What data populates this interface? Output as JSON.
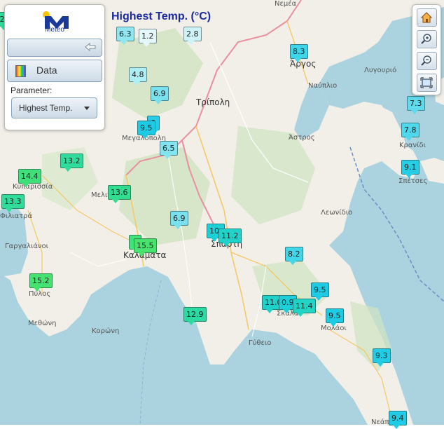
{
  "title": "Highest Temp. (°C)",
  "panel": {
    "logo_text": "Meteo",
    "data_label": "Data",
    "parameter_label": "Parameter:",
    "parameter_value": "Highest Temp.",
    "logo_icon": "meteo-logo-icon",
    "slider_icon": "arrow-left-icon",
    "data_icon": "color-scale-icon"
  },
  "toolbar": {
    "home_icon": "home-icon",
    "zoom_in_icon": "zoom-in-icon",
    "zoom_out_icon": "zoom-out-icon",
    "extent_icon": "full-extent-icon"
  },
  "places": [
    {
      "id": "nemea",
      "label": "Νεμέα"
    },
    {
      "id": "argos",
      "label": "Άργος"
    },
    {
      "id": "lygourio",
      "label": "Λυγουριό"
    },
    {
      "id": "nafplio",
      "label": "Ναύπλιο"
    },
    {
      "id": "tripoli",
      "label": "Τρίπολη"
    },
    {
      "id": "megalopoli",
      "label": "Μεγαλόπολη"
    },
    {
      "id": "astros",
      "label": "Άστρος"
    },
    {
      "id": "kranidi",
      "label": "Κρανίδι"
    },
    {
      "id": "spetses",
      "label": "Σπέτσες"
    },
    {
      "id": "kyparissia",
      "label": "Κυπαρισσία"
    },
    {
      "id": "meligalas",
      "label": "Μελιγαλάς"
    },
    {
      "id": "filiatra",
      "label": "Φιλιατρά"
    },
    {
      "id": "leonidio",
      "label": "Λεωνίδιο"
    },
    {
      "id": "gargalianoi",
      "label": "Γαργαλιάνοι"
    },
    {
      "id": "kalamata",
      "label": "Καλαμάτα"
    },
    {
      "id": "sparti",
      "label": "Σπάρτη"
    },
    {
      "id": "pylos",
      "label": "Πύλος"
    },
    {
      "id": "skala",
      "label": "Σκάλα"
    },
    {
      "id": "molaoi",
      "label": "Μολάοι"
    },
    {
      "id": "methoni",
      "label": "Μεθώνη"
    },
    {
      "id": "koroni",
      "label": "Κορώνη"
    },
    {
      "id": "gytheio",
      "label": "Γύθειο"
    },
    {
      "id": "neapoli",
      "label": "Νεάπ"
    }
  ],
  "markers": [
    {
      "value": "6.3",
      "color": "#8fe6f0"
    },
    {
      "value": "1.2",
      "color": "#e4f7fa"
    },
    {
      "value": "2.8",
      "color": "#cdf3f8"
    },
    {
      "value": "8.3",
      "color": "#3fd5ea"
    },
    {
      "value": "4.8",
      "color": "#aeeef5"
    },
    {
      "value": "6.9",
      "color": "#79e0ee"
    },
    {
      "value": "9",
      "color": "#26cde6"
    },
    {
      "value": "9.5",
      "color": "#1dcbe4"
    },
    {
      "value": "6.5",
      "color": "#83e3ef"
    },
    {
      "value": "7.3",
      "color": "#60dbec"
    },
    {
      "value": "7.8",
      "color": "#4fd7eb"
    },
    {
      "value": "9.1",
      "color": "#25cde5"
    },
    {
      "value": "13.2",
      "color": "#2fdc9b"
    },
    {
      "value": "14.4",
      "color": "#3fe07a"
    },
    {
      "value": "13.6",
      "color": "#33dd90"
    },
    {
      "value": "13.3",
      "color": "#30dc99"
    },
    {
      "value": "6.9",
      "color": "#79e0ee"
    },
    {
      "value": "10.",
      "color": "#1bd0d6"
    },
    {
      "value": "11.2",
      "color": "#20d3c8"
    },
    {
      "value": "1",
      "color": "#40e27a"
    },
    {
      "value": "15.5",
      "color": "#48e36c"
    },
    {
      "value": "8.2",
      "color": "#42d6ea"
    },
    {
      "value": "15.2",
      "color": "#46e270"
    },
    {
      "value": "9.5",
      "color": "#1dcbe4"
    },
    {
      "value": "11.0",
      "color": "#1ed2ca"
    },
    {
      "value": "0.9",
      "color": "#1ccfd8"
    },
    {
      "value": "11.4",
      "color": "#22d4c3"
    },
    {
      "value": "9.5",
      "color": "#1dcbe4"
    },
    {
      "value": "12.9",
      "color": "#2cdba2"
    },
    {
      "value": "9.3",
      "color": "#22cce5"
    },
    {
      "value": "9.4",
      "color": "#20cce5"
    },
    {
      "value": "2",
      "color": "#2fdc9b"
    }
  ]
}
